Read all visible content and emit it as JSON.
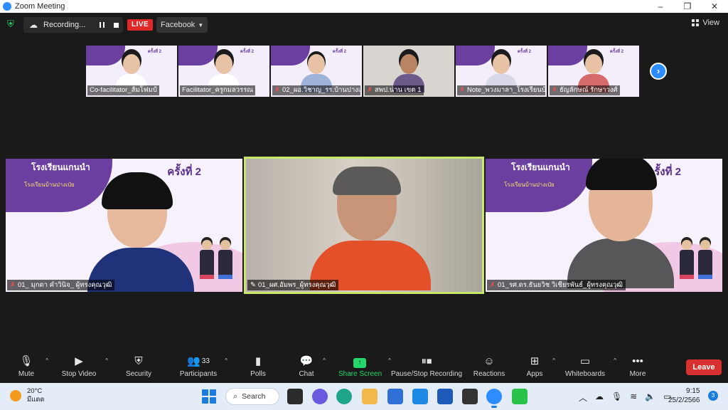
{
  "window": {
    "title": "Zoom Meeting",
    "controls": [
      "–",
      "❐",
      "✕"
    ]
  },
  "topbar": {
    "recording_label": "Recording...",
    "live_label": "LIVE",
    "stream_target": "Facebook",
    "view_label": "View"
  },
  "thumbnails": [
    {
      "name": "Co-facilitator_ส้มโฟมป์",
      "muted": false,
      "round": "ครั้งที่ 2"
    },
    {
      "name": "Facilitator_ครูกมลวรรณ",
      "muted": false,
      "round": "ครั้งที่ 2"
    },
    {
      "name": "02_ผอ.วิชาญ_รร.บ้านปางเป...",
      "muted": true,
      "round": "ครั้งที่ 2"
    },
    {
      "name": "สพป.น่าน เขต 1",
      "muted": true,
      "round": ""
    },
    {
      "name": "Note_พวงมาลา_โรงเรียนบ้...",
      "muted": true,
      "round": "ครั้งที่ 2"
    },
    {
      "name": "ธัญลักษณ์ รักษาวงศ์",
      "muted": true,
      "round": "ครั้งที่ 2"
    }
  ],
  "tiles": [
    {
      "name": "01_ มุกดา คำวินิจ_ ผู้ทรงคุณวุฒิ",
      "muted": true,
      "banner_title": "โรงเรียนแกนนำ",
      "banner_sub": "โรงเรียนบ้านปางเป๋ย",
      "round": "ครั้งที่ 2"
    },
    {
      "name": "01_ผศ.อัมพร_ผู้ทรงคุณวุฒิ",
      "muted": false,
      "banner_title": "",
      "banner_sub": "",
      "round": ""
    },
    {
      "name": "01_รศ.ดร.ธันยวิช วิเชียรพันธ์_ผู้ทรงคุณวุฒิ",
      "muted": true,
      "banner_title": "โรงเรียนแกนนำ",
      "banner_sub": "โรงเรียนบ้านปางเป๋ย",
      "round": "ครั้งที่ 2"
    }
  ],
  "toolbar": {
    "mute": "Mute",
    "stop_video": "Stop Video",
    "security": "Security",
    "participants": "Participants",
    "participants_count": "33",
    "polls": "Polls",
    "chat": "Chat",
    "share_screen": "Share Screen",
    "pause_stop_recording": "Pause/Stop Recording",
    "reactions": "Reactions",
    "apps": "Apps",
    "whiteboards": "Whiteboards",
    "more": "More",
    "leave": "Leave"
  },
  "taskbar": {
    "temperature": "20°C",
    "weather_desc": "มีแดด",
    "search_label": "Search",
    "time": "9:15",
    "date": "25/2/2566",
    "notifications": "3"
  },
  "colors": {
    "accent": "#2d8cff",
    "live": "#e02828",
    "share": "#23d96b",
    "leave": "#d9312f",
    "speaker_border": "#c8e66a"
  }
}
